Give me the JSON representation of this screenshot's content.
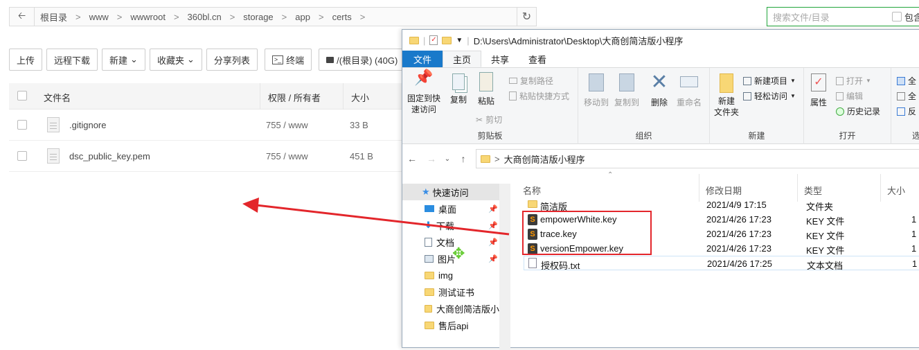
{
  "web": {
    "breadcrumbs": [
      "根目录",
      "www",
      "wwwroot",
      "360bl.cn",
      "storage",
      "app",
      "certs"
    ],
    "search_placeholder": "搜索文件/目录",
    "search_include_label": "包含",
    "toolbar": {
      "upload": "上传",
      "remote_download": "远程下载",
      "new": "新建",
      "favorites": "收藏夹",
      "share_list": "分享列表",
      "terminal": "终端",
      "disk": "/(根目录) (40G)"
    },
    "columns": {
      "name": "文件名",
      "perm": "权限 / 所有者",
      "size": "大小"
    },
    "files": [
      {
        "name": ".gitignore",
        "perm": "755 / www",
        "size": "33 B"
      },
      {
        "name": "dsc_public_key.pem",
        "perm": "755 / www",
        "size": "451 B"
      }
    ]
  },
  "explorer": {
    "title": "D:\\Users\\Administrator\\Desktop\\大商创简洁版小程序",
    "tabs": {
      "file": "文件",
      "home": "主页",
      "share": "共享",
      "view": "查看"
    },
    "ribbon": {
      "pin": [
        "固定到快",
        "速访问"
      ],
      "copy": "复制",
      "paste": "粘贴",
      "copy_path": "复制路径",
      "paste_shortcut": "粘贴快捷方式",
      "cut": "剪切",
      "clipboard": "剪贴板",
      "move_to": "移动到",
      "copy_to": "复制到",
      "delete": "删除",
      "rename": "重命名",
      "organize": "组织",
      "new_folder": [
        "新建",
        "文件夹"
      ],
      "new_item": "新建项目",
      "easy_access": "轻松访问",
      "new_group": "新建",
      "properties": "属性",
      "open": "打开",
      "edit": "编辑",
      "history": "历史记录",
      "open_group": "打开",
      "select_all_partial": "全",
      "select_none_partial": "全",
      "invert_partial": "反",
      "select_partial": "选"
    },
    "address": "大商创简洁版小程序",
    "nav": [
      {
        "label": "快速访问"
      },
      {
        "label": "桌面"
      },
      {
        "label": "下载"
      },
      {
        "label": "文档"
      },
      {
        "label": "图片"
      },
      {
        "label": "img"
      },
      {
        "label": "测试证书"
      },
      {
        "label": "大商创简洁版小"
      },
      {
        "label": "售后api"
      }
    ],
    "columns": {
      "name": "名称",
      "modified": "修改日期",
      "type": "类型",
      "size": "大小"
    },
    "files": [
      {
        "name": "简洁版",
        "modified": "2021/4/9 17:15",
        "type": "文件夹",
        "size": ""
      },
      {
        "name": "empowerWhite.key",
        "modified": "2021/4/26 17:23",
        "type": "KEY 文件",
        "size": "1"
      },
      {
        "name": "trace.key",
        "modified": "2021/4/26 17:23",
        "type": "KEY 文件",
        "size": "1"
      },
      {
        "name": "versionEmpower.key",
        "modified": "2021/4/26 17:23",
        "type": "KEY 文件",
        "size": "1"
      },
      {
        "name": "授权码.txt",
        "modified": "2021/4/26 17:25",
        "type": "文本文档",
        "size": "1"
      }
    ]
  },
  "colors": {
    "accent_green": "#20a53a",
    "explorer_blue": "#1979ca",
    "highlight_red": "#e3262b"
  }
}
